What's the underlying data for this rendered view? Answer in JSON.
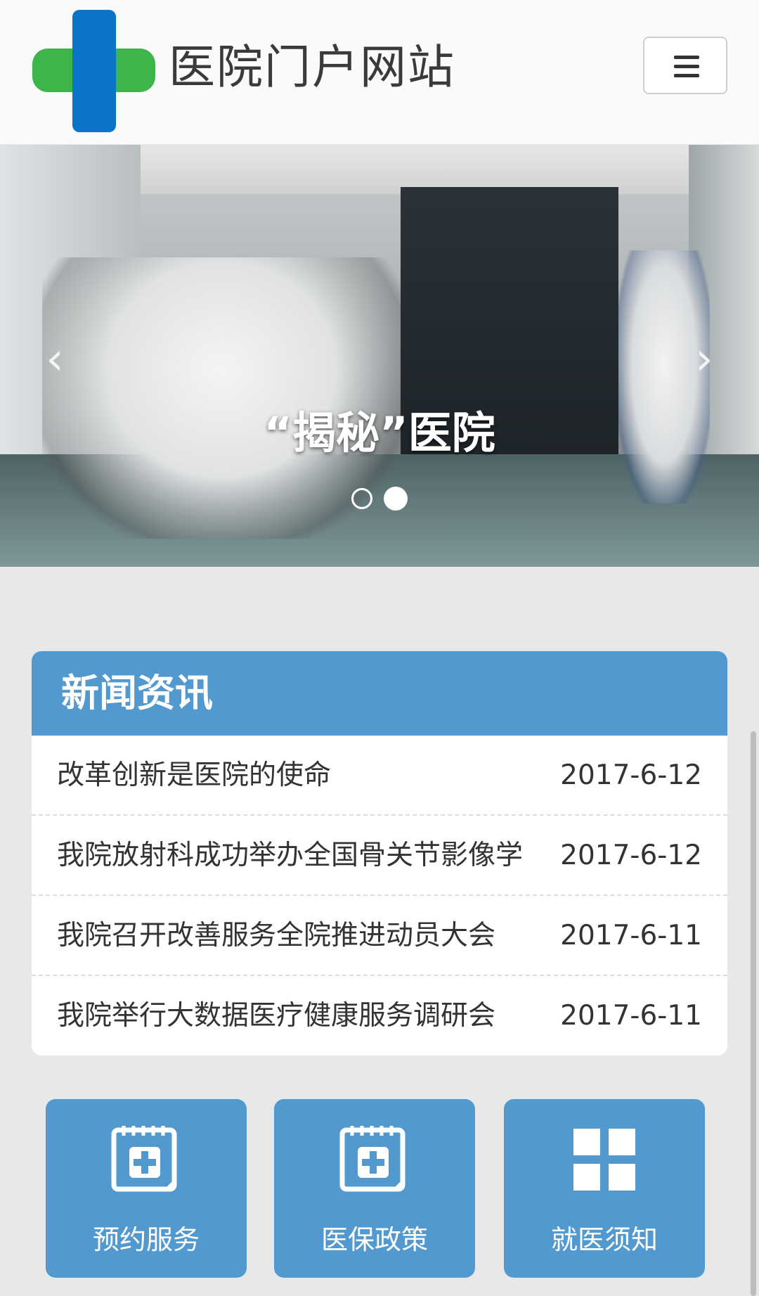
{
  "header": {
    "site_title": "医院门户网站",
    "logo_icon": "cross-logo",
    "menu_icon": "hamburger-icon",
    "colors": {
      "logo_green": "#3db54a",
      "logo_blue": "#0a74c6"
    }
  },
  "banner": {
    "caption": "“揭秘”医院",
    "prev_arrow": "‹",
    "next_arrow": "›",
    "slides_total": 2,
    "active_slide": 2
  },
  "news": {
    "title": "新闻资讯",
    "accent": "#5199ce",
    "items": [
      {
        "title": "改革创新是医院的使命",
        "date": "2017-6-12"
      },
      {
        "title": "我院放射科成功举办全国骨关节影像学",
        "date": "2017-6-12"
      },
      {
        "title": "我院召开改善服务全院推进动员大会",
        "date": "2017-6-11"
      },
      {
        "title": "我院举行大数据医疗健康服务调研会",
        "date": "2017-6-11"
      }
    ]
  },
  "tiles": [
    {
      "label": "预约服务",
      "icon": "calendar-plus-icon"
    },
    {
      "label": "医保政策",
      "icon": "calendar-plus-icon"
    },
    {
      "label": "就医须知",
      "icon": "grid-icon"
    }
  ]
}
